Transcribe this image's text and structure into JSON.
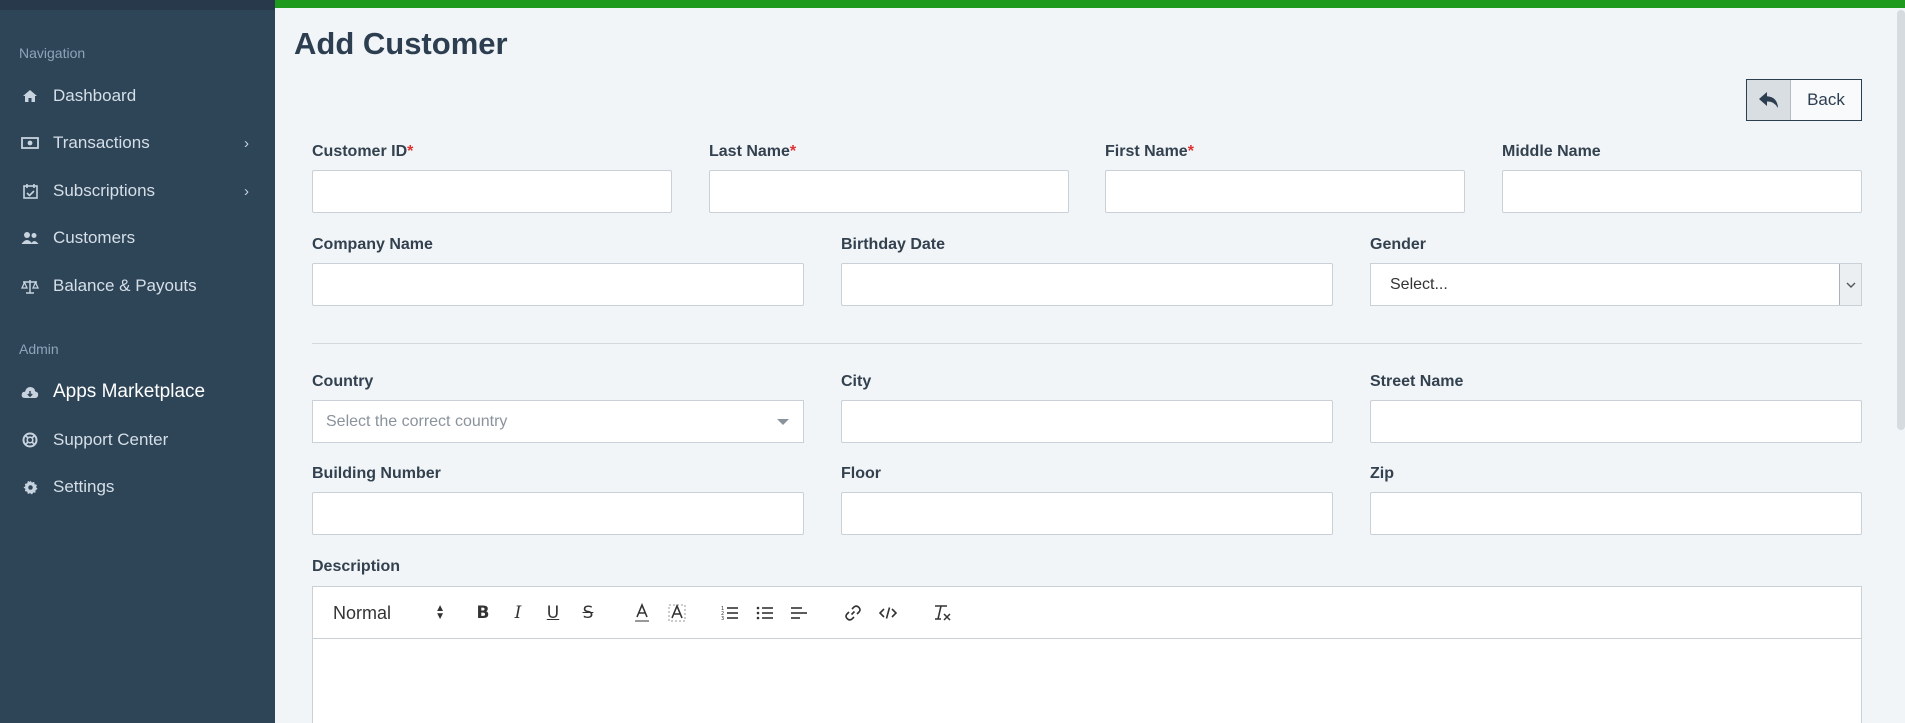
{
  "sidebar": {
    "sections": [
      {
        "label": "Navigation"
      },
      {
        "label": "Admin"
      }
    ],
    "items": [
      {
        "label": "Dashboard",
        "icon": "home-icon"
      },
      {
        "label": "Transactions",
        "icon": "money-icon"
      },
      {
        "label": "Subscriptions",
        "icon": "calendar-check-icon"
      },
      {
        "label": "Customers",
        "icon": "users-icon"
      },
      {
        "label": "Balance & Payouts",
        "icon": "scale-icon"
      },
      {
        "label": "Apps Marketplace",
        "icon": "cloud-download-icon"
      },
      {
        "label": "Support Center",
        "icon": "lifebuoy-icon"
      },
      {
        "label": "Settings",
        "icon": "gear-icon"
      }
    ]
  },
  "page": {
    "title": "Add Customer",
    "back_label": "Back"
  },
  "form": {
    "customer_id": {
      "label": "Customer ID",
      "required": "*",
      "value": ""
    },
    "last_name": {
      "label": "Last Name",
      "required": "*",
      "value": ""
    },
    "first_name": {
      "label": "First Name",
      "required": "*",
      "value": ""
    },
    "middle_name": {
      "label": "Middle Name",
      "value": ""
    },
    "company_name": {
      "label": "Company Name",
      "value": ""
    },
    "birthday_date": {
      "label": "Birthday Date",
      "value": ""
    },
    "gender": {
      "label": "Gender",
      "selected": "Select..."
    },
    "country": {
      "label": "Country",
      "placeholder": "Select the correct country"
    },
    "city": {
      "label": "City",
      "value": ""
    },
    "street_name": {
      "label": "Street Name",
      "value": ""
    },
    "building_number": {
      "label": "Building Number",
      "value": ""
    },
    "floor": {
      "label": "Floor",
      "value": ""
    },
    "zip": {
      "label": "Zip",
      "value": ""
    },
    "description": {
      "label": "Description",
      "format": "Normal"
    }
  },
  "colors": {
    "sidebar_bg": "#2e4457",
    "top_accent": "#1e9b1e",
    "required": "#e03131"
  }
}
